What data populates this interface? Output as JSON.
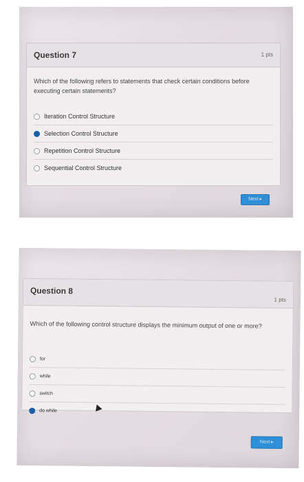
{
  "q7": {
    "title": "Question 7",
    "points": "1 pts",
    "prompt": "Which of the following refers to statements that check certain conditions before executing certain statements?",
    "options": [
      {
        "label": "Iteration Control Structure",
        "selected": false
      },
      {
        "label": "Selection Control Structure",
        "selected": true
      },
      {
        "label": "Repetition Control Structure",
        "selected": false
      },
      {
        "label": "Sequential Control Structure",
        "selected": false
      }
    ],
    "next_label": "Next ▸"
  },
  "q8": {
    "title": "Question 8",
    "points": "1 pts",
    "prompt": "Which of the following control structure displays the minimum output of one or more?",
    "options": [
      {
        "label": "for",
        "selected": false
      },
      {
        "label": "while",
        "selected": false
      },
      {
        "label": "switch",
        "selected": false
      },
      {
        "label": "do while",
        "selected": true
      }
    ],
    "next_label": "Next ▸"
  },
  "colors": {
    "accent": "#2f8fd6",
    "selected_radio": "#1b5fa8"
  }
}
